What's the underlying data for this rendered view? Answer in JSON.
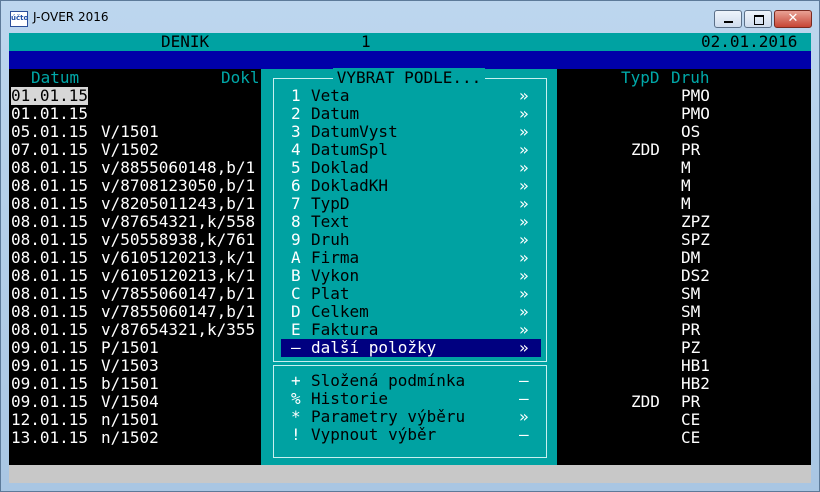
{
  "window": {
    "title": "J-OVER 2016",
    "icon_label": "účto"
  },
  "header": {
    "left": "DENIK",
    "center": "1",
    "right": "02.01.2016"
  },
  "columns": {
    "datum": "Datum",
    "dokl": "Dokl",
    "typd": "TypD",
    "druh": "Druh"
  },
  "rows": [
    {
      "datum": "01.01.15",
      "dokl": "",
      "typd": "",
      "druh": "PMO"
    },
    {
      "datum": "01.01.15",
      "dokl": "",
      "typd": "",
      "druh": "PMO"
    },
    {
      "datum": "05.01.15",
      "dokl": "V/1501",
      "typd": "",
      "druh": "OS"
    },
    {
      "datum": "07.01.15",
      "dokl": "V/1502",
      "typd": "ZDD",
      "druh": "PR"
    },
    {
      "datum": "08.01.15",
      "dokl": "v/8855060148,b/1",
      "typd": "",
      "druh": "M"
    },
    {
      "datum": "08.01.15",
      "dokl": "v/8708123050,b/1",
      "typd": "",
      "druh": "M"
    },
    {
      "datum": "08.01.15",
      "dokl": "v/8205011243,b/1",
      "typd": "",
      "druh": "M"
    },
    {
      "datum": "08.01.15",
      "dokl": "v/87654321,k/558",
      "typd": "",
      "druh": "ZPZ"
    },
    {
      "datum": "08.01.15",
      "dokl": "v/50558938,k/761",
      "typd": "",
      "druh": "SPZ"
    },
    {
      "datum": "08.01.15",
      "dokl": "v/6105120213,k/1",
      "typd": "",
      "druh": "DM"
    },
    {
      "datum": "08.01.15",
      "dokl": "v/6105120213,k/1",
      "typd": "",
      "druh": "DS2"
    },
    {
      "datum": "08.01.15",
      "dokl": "v/7855060147,b/1",
      "typd": "",
      "druh": "SM"
    },
    {
      "datum": "08.01.15",
      "dokl": "v/7855060147,b/1",
      "typd": "",
      "druh": "SM"
    },
    {
      "datum": "08.01.15",
      "dokl": "v/87654321,k/355",
      "typd": "",
      "druh": "PR"
    },
    {
      "datum": "09.01.15",
      "dokl": "P/1501",
      "typd": "",
      "druh": "PZ"
    },
    {
      "datum": "09.01.15",
      "dokl": "V/1503",
      "typd": "",
      "druh": "HB1"
    },
    {
      "datum": "09.01.15",
      "dokl": "b/1501",
      "typd": "",
      "druh": "HB2"
    },
    {
      "datum": "09.01.15",
      "dokl": "V/1504",
      "typd": "ZDD",
      "druh": "PR"
    },
    {
      "datum": "12.01.15",
      "dokl": "n/1501",
      "typd": "",
      "druh": "CE"
    },
    {
      "datum": "13.01.15",
      "dokl": "n/1502",
      "typd": "",
      "druh": "CE"
    }
  ],
  "menu": {
    "title": "VYBRAT PODLE...",
    "items": [
      {
        "key": "1",
        "label": "Veta",
        "arrow": "»"
      },
      {
        "key": "2",
        "label": "Datum",
        "arrow": "»"
      },
      {
        "key": "3",
        "label": "DatumVyst",
        "arrow": "»"
      },
      {
        "key": "4",
        "label": "DatumSpl",
        "arrow": "»"
      },
      {
        "key": "5",
        "label": "Doklad",
        "arrow": "»"
      },
      {
        "key": "6",
        "label": "DokladKH",
        "arrow": "»"
      },
      {
        "key": "7",
        "label": "TypD",
        "arrow": "»"
      },
      {
        "key": "8",
        "label": "Text",
        "arrow": "»"
      },
      {
        "key": "9",
        "label": "Druh",
        "arrow": "»"
      },
      {
        "key": "A",
        "label": "Firma",
        "arrow": "»"
      },
      {
        "key": "B",
        "label": "Vykon",
        "arrow": "»"
      },
      {
        "key": "C",
        "label": "Plat",
        "arrow": "»"
      },
      {
        "key": "D",
        "label": "Celkem",
        "arrow": "»"
      },
      {
        "key": "E",
        "label": "Faktura",
        "arrow": "»"
      },
      {
        "key": "–",
        "label": "další položky",
        "arrow": "»"
      }
    ],
    "extra_items": [
      {
        "key": "+",
        "label": "Složená podmínka",
        "arrow": "–"
      },
      {
        "key": "%",
        "label": "Historie",
        "arrow": "–"
      },
      {
        "key": "*",
        "label": "Parametry výběru",
        "arrow": "»"
      },
      {
        "key": "!",
        "label": "Vypnout výběr",
        "arrow": "–"
      }
    ]
  },
  "colors": {
    "cyan": "#00a2a2",
    "navy": "#000080",
    "blue_band": "#0000a8"
  }
}
